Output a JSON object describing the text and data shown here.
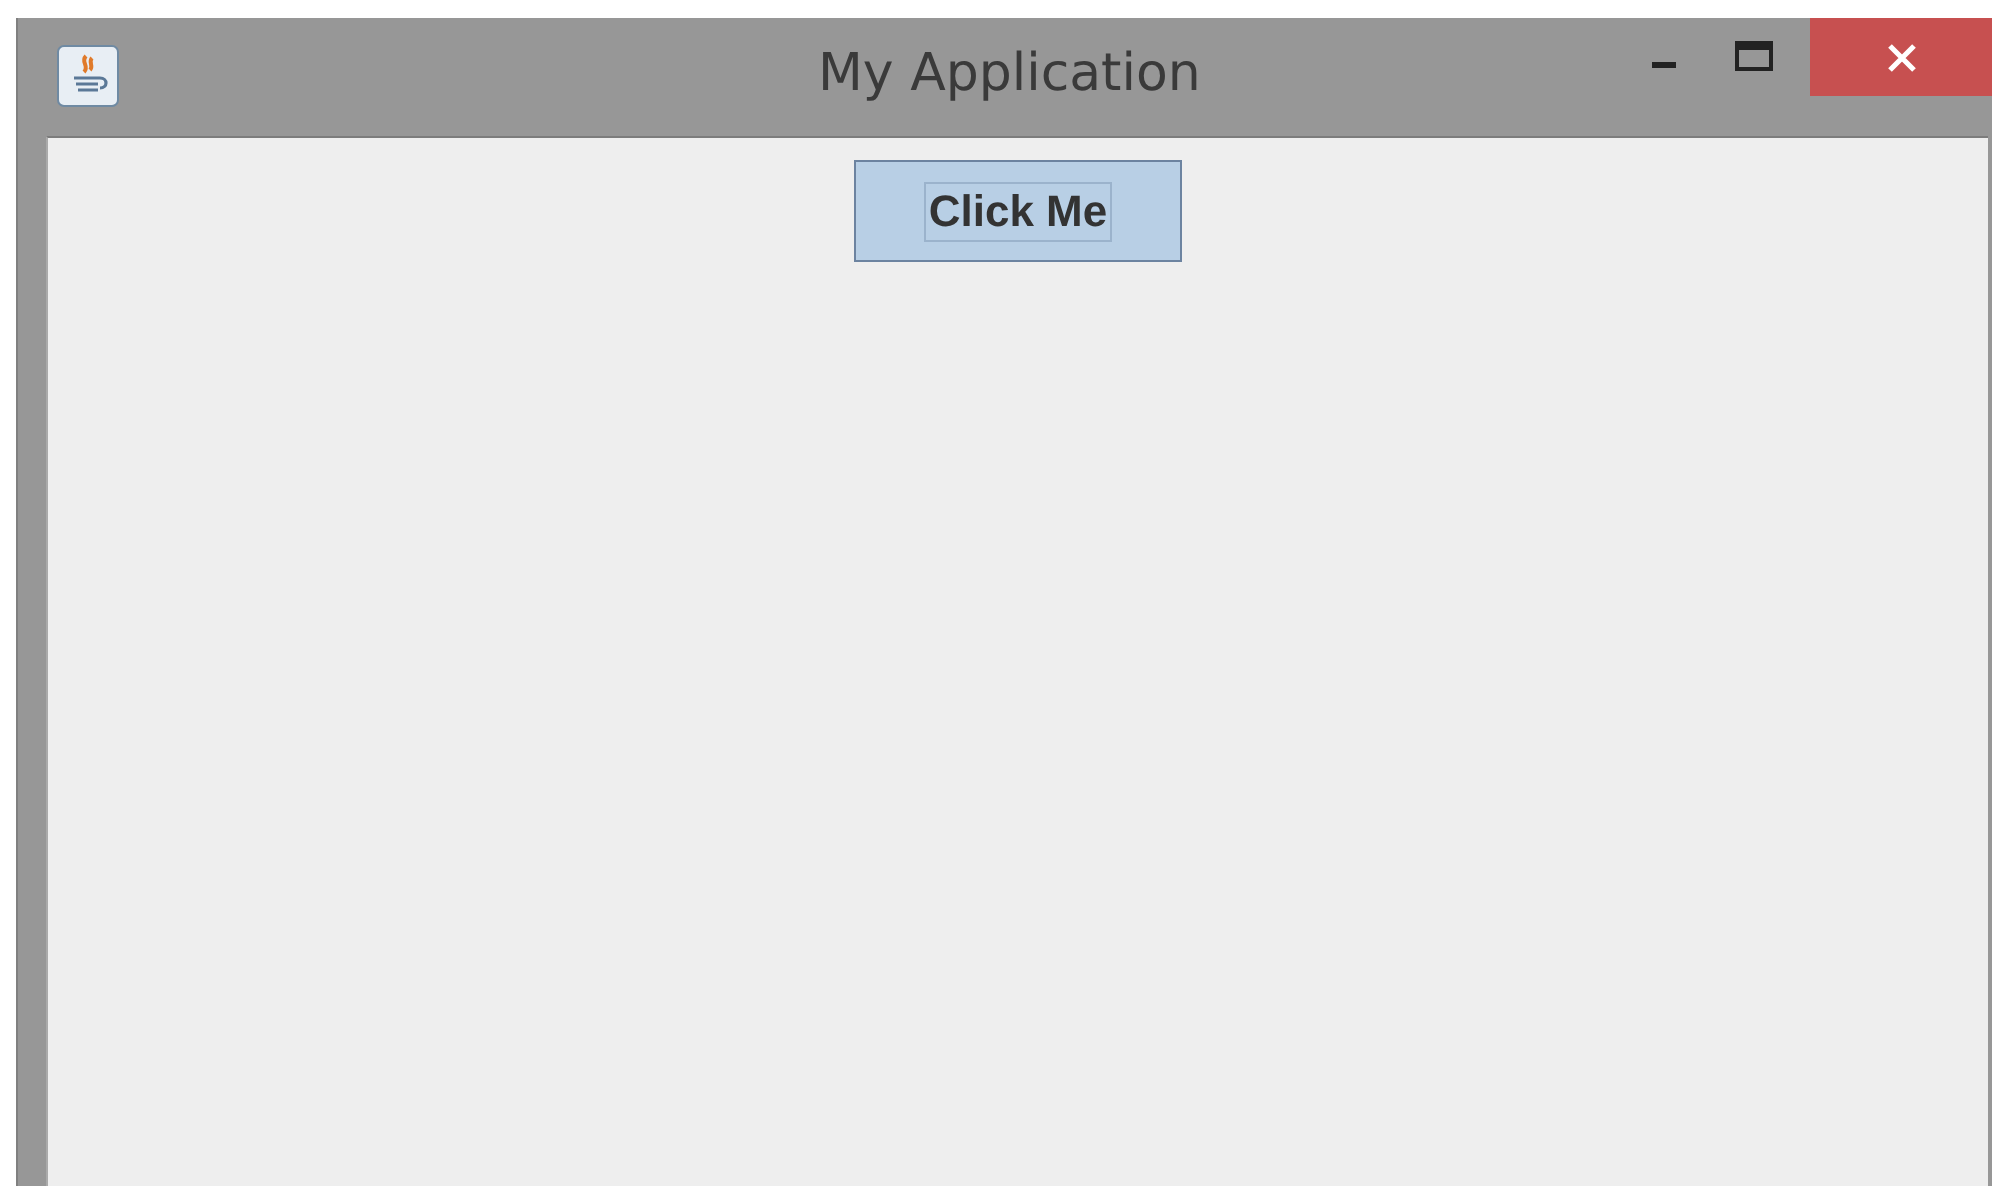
{
  "window": {
    "title": "My Application"
  },
  "button": {
    "label": "Click Me",
    "focused": true
  }
}
